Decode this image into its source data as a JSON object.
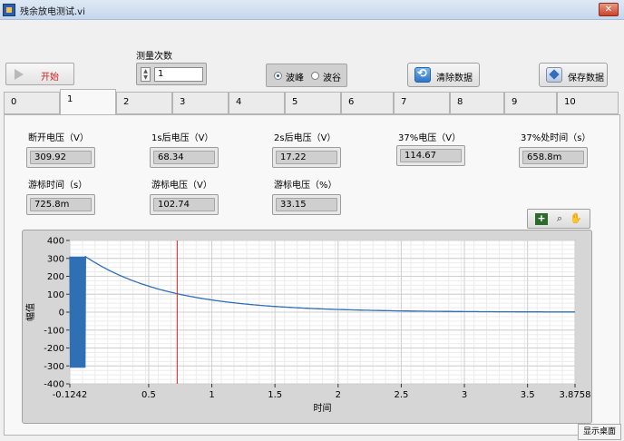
{
  "window": {
    "title": "残余放电测试.vi",
    "close": "✕"
  },
  "controls": {
    "start_label": "开始",
    "count_label": "测量次数",
    "count_value": "1",
    "radio": [
      {
        "label": "波峰",
        "selected": true
      },
      {
        "label": "波谷",
        "selected": false
      }
    ],
    "clear_label": "清除数据",
    "save_label": "保存数据"
  },
  "tabs": [
    "0",
    "1",
    "2",
    "3",
    "4",
    "5",
    "6",
    "7",
    "8",
    "9",
    "10"
  ],
  "active_tab": "1",
  "indicators": [
    {
      "label": "断开电压（V）",
      "value": "309.92"
    },
    {
      "label": "1s后电压（V）",
      "value": "68.34"
    },
    {
      "label": "2s后电压（V）",
      "value": "17.22"
    },
    {
      "label": "37%电压（V）",
      "value": "114.67"
    },
    {
      "label": "37%处时间（s）",
      "value": "658.8m"
    },
    {
      "label": "游标时间（s）",
      "value": "725.8m"
    },
    {
      "label": "游标电压（V）",
      "value": "102.74"
    },
    {
      "label": "游标电压（%）",
      "value": "33.15"
    }
  ],
  "chart_data": {
    "type": "line",
    "xlabel": "时间",
    "ylabel": "幅值",
    "xlim": [
      -0.1242,
      3.8758
    ],
    "ylim": [
      -400,
      400
    ],
    "x_ticks": [
      "-0.1242",
      "0.5",
      "1",
      "1.5",
      "2",
      "2.5",
      "3",
      "3.5",
      "3.8758"
    ],
    "x_tick_values": [
      -0.1242,
      0.5,
      1,
      1.5,
      2,
      2.5,
      3,
      3.5,
      3.8758
    ],
    "y_ticks": [
      "400",
      "300",
      "200",
      "100",
      "0",
      "-100",
      "-200",
      "-300",
      "-400"
    ],
    "y_tick_values": [
      400,
      300,
      200,
      100,
      0,
      -100,
      -200,
      -300,
      -400
    ],
    "grid": true,
    "cursor_x": 0.7258,
    "series_color": "#2f6fb3",
    "cursor_color": "#e02020",
    "series": [
      {
        "oscillation": {
          "x_start": -0.1242,
          "x_end": 0,
          "amplitude": 310
        },
        "decay": {
          "x_start": 0,
          "x_end": 3.8758,
          "v0": 309.92,
          "time_constant": 0.6588
        }
      }
    ]
  },
  "taskbar_tip": "显示桌面"
}
